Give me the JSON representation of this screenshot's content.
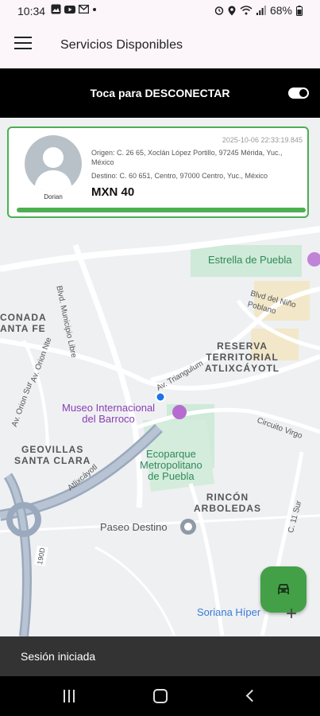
{
  "status_bar": {
    "time": "10:34",
    "battery": "68%",
    "left_icons": [
      "photos-icon",
      "youtube-icon",
      "gmail-icon",
      "dot-icon"
    ],
    "right_icons": [
      "alarm-icon",
      "location-icon",
      "wifi-icon",
      "signal-icon",
      "battery-icon"
    ]
  },
  "app_bar": {
    "title": "Servicios Disponibles",
    "menu_icon": "hamburger-menu-icon"
  },
  "connection": {
    "label": "Toca para DESCONECTAR",
    "toggle_on": true
  },
  "request_card": {
    "driver_name": "Dorian",
    "timestamp": "2025-10-06 22:33:19.845",
    "origin": "Origen: C. 26 65, Xoclán López Portillo, 97245 Mérida, Yuc., México",
    "destination": "Destino: C. 60 651, Centro, 97000 Centro, Yuc., México",
    "price": "MXN 40",
    "progress": 1.0,
    "accent": "#4caf50"
  },
  "map": {
    "labels": {
      "estrella": "Estrella de Puebla",
      "conada": "CONADA\nANTA FE",
      "reserva": "RESERVA\nTERRITORIAL\nATLIXCÁYOTL",
      "museo": "Museo Internacional\ndel Barroco",
      "geovillas": "GEOVILLAS\nSANTA CLARA",
      "ecoparque": "Ecoparque\nMetropolitano\nde Puebla",
      "rincon": "RINCÓN\nARBOLEDAS",
      "paseo": "Paseo Destino",
      "soriana": "Soriana Híper",
      "blvd_municipio": "Blvd. Municipio Libre",
      "blvd_nino": "Blvd del Niño Poblano",
      "av_orion": "Av. Orion Nte",
      "av_orion_sur": "Av. Orion Sur",
      "av_triangulo": "Av. Triangulum",
      "circuito": "Circuito Virgo",
      "atlixcayotl": "Atlixcáyotl",
      "c11": "C. 11 Sur",
      "route190": "190D"
    }
  },
  "fab": {
    "icon": "car-icon"
  },
  "snackbar": {
    "text": "Sesión iniciada"
  },
  "nav_bar": {
    "icons": [
      "recents-icon",
      "home-icon",
      "back-icon"
    ]
  }
}
